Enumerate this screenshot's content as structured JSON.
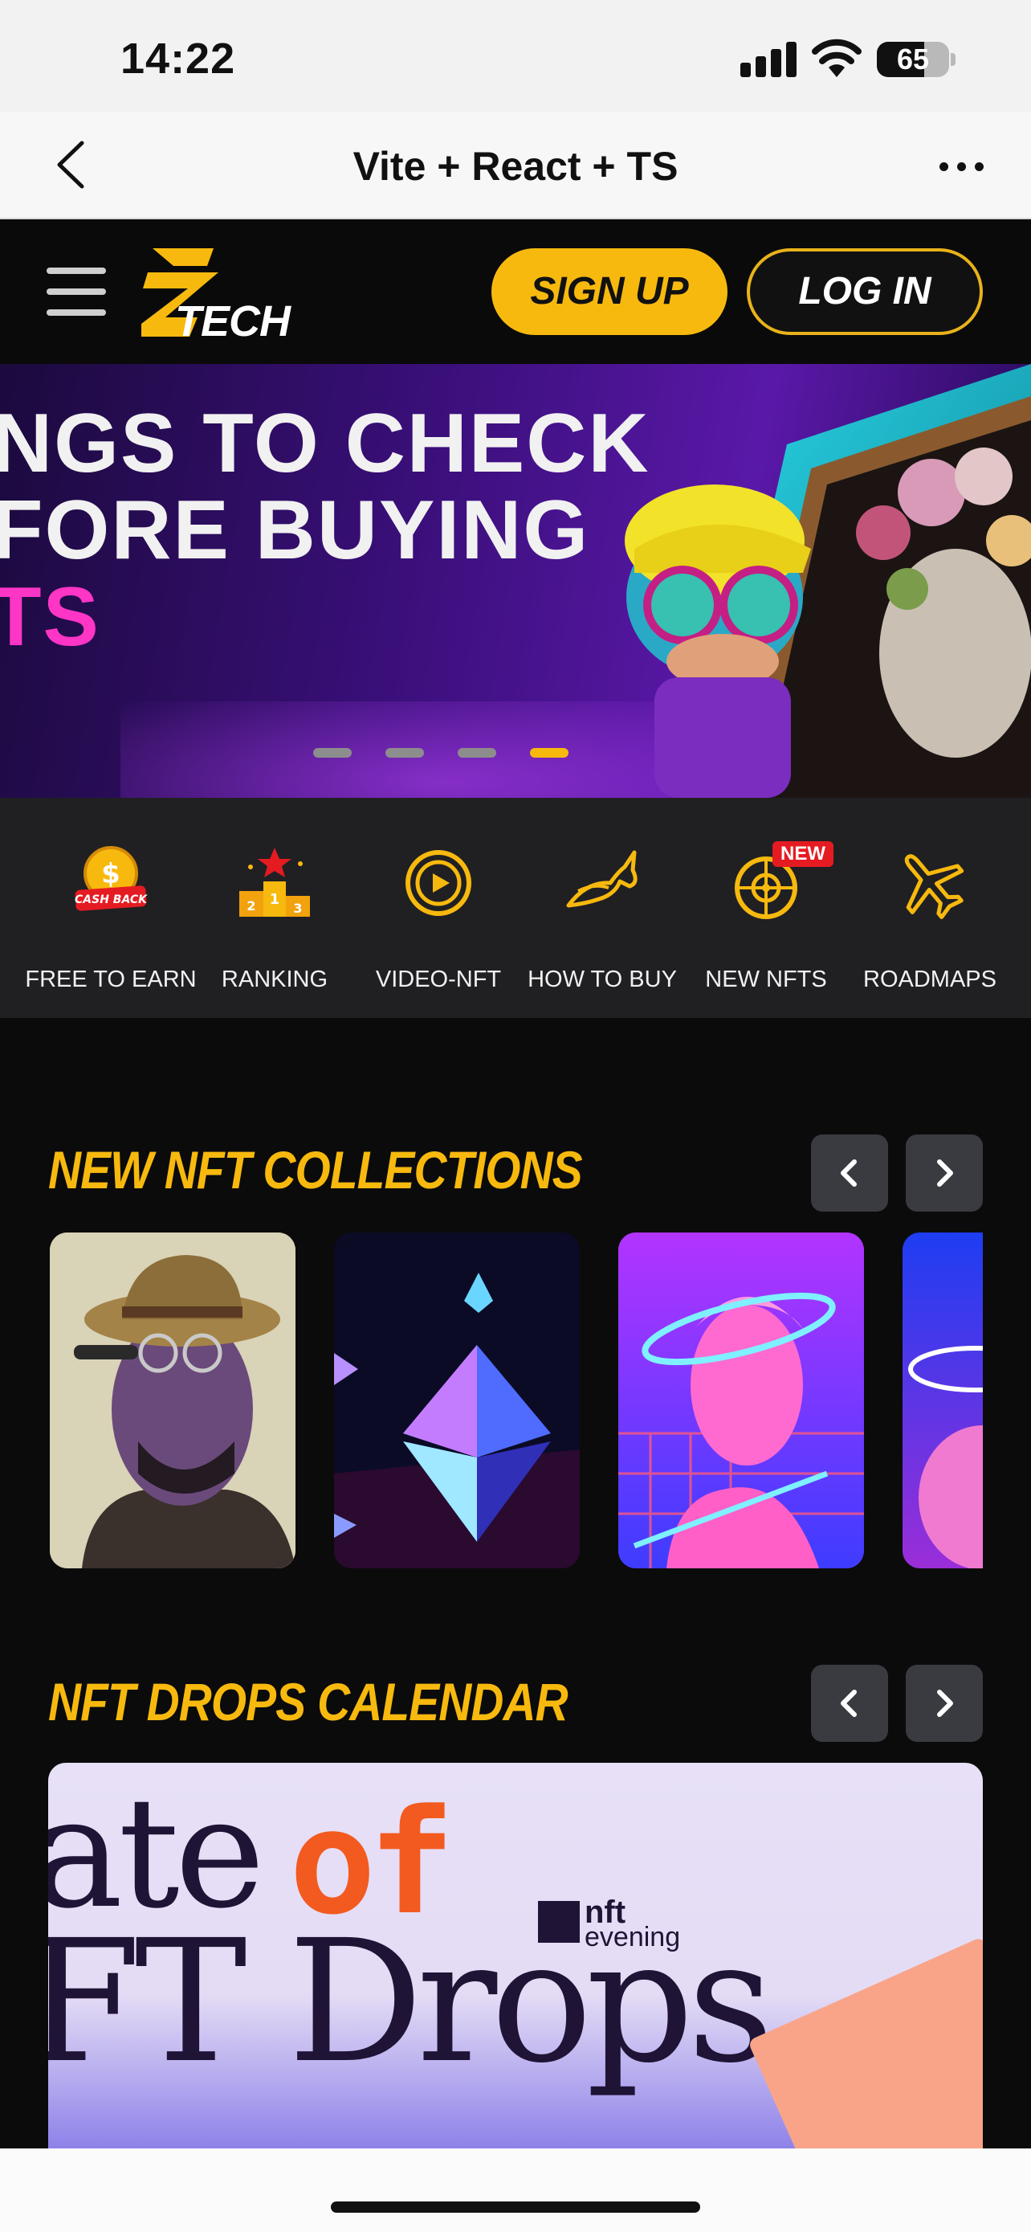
{
  "status_bar": {
    "time": "14:22",
    "battery": "65",
    "battery_level": 0.65
  },
  "browser": {
    "title": "Vite + React + TS"
  },
  "header": {
    "logo_text": "TECH",
    "signup_label": "SIGN UP",
    "login_label": "LOG IN"
  },
  "banner": {
    "line1": "NGS TO CHECK",
    "line2": "FORE BUYING",
    "line3": "TS",
    "slide_count": 4,
    "active_slide": 4
  },
  "quick_menu": [
    {
      "label": "FREE TO EARN",
      "icon": "cash-back-coin-icon",
      "icon_text": "CASH BACK"
    },
    {
      "label": "RANKING",
      "icon": "podium-star-icon"
    },
    {
      "label": "VIDEO-NFT",
      "icon": "play-circle-icon"
    },
    {
      "label": "HOW TO BUY",
      "icon": "horse-icon"
    },
    {
      "label": "NEW NFTS",
      "icon": "roulette-wheel-icon",
      "badge": "NEW"
    },
    {
      "label": "ROADMAPS",
      "icon": "airplane-icon"
    }
  ],
  "collections": {
    "title": "NEW NFT COLLECTIONS"
  },
  "drops": {
    "title": "NFT DROPS CALENDAR",
    "image_text_1": "ate",
    "image_text_of": "of",
    "image_text_2": "FT Drops",
    "brand_top": "nft",
    "brand_bottom": "evening"
  },
  "colors": {
    "accent": "#f7b90e",
    "background": "#0b0b0c",
    "menu_bg": "#202023",
    "arrow_bg": "#3a3b40"
  }
}
